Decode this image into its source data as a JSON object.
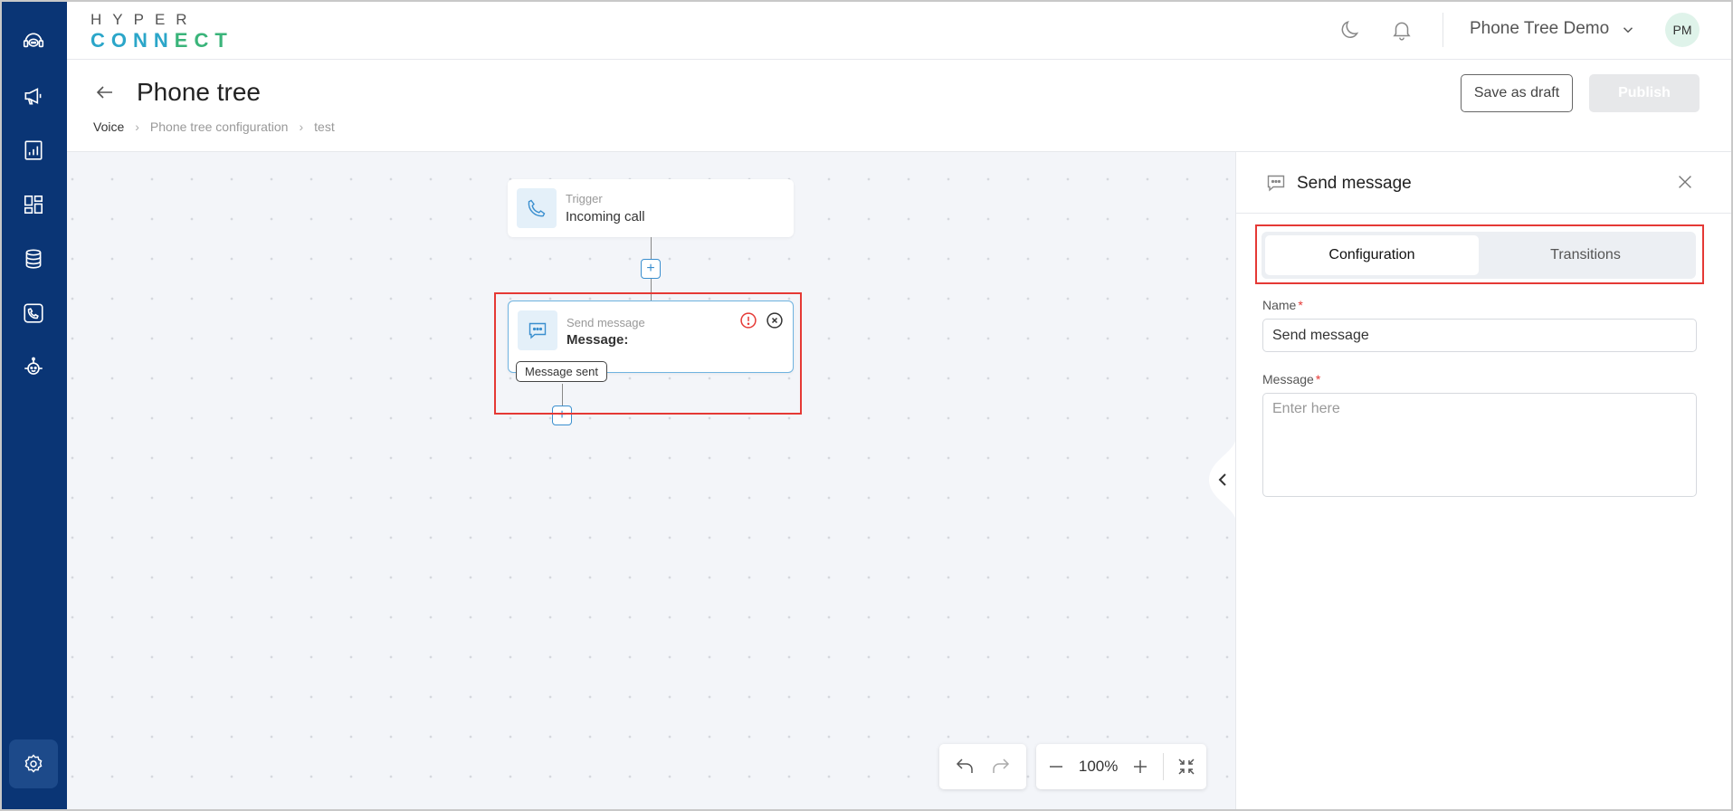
{
  "logo": {
    "top": "HYPER",
    "bottom_a": "CONN",
    "bottom_b": "ECT"
  },
  "header": {
    "org_name": "Phone Tree Demo",
    "avatar_initials": "PM"
  },
  "page": {
    "title": "Phone tree",
    "breadcrumb": [
      "Voice",
      "Phone tree configuration",
      "test"
    ],
    "save_draft_label": "Save as draft",
    "publish_label": "Publish"
  },
  "canvas": {
    "trigger_node": {
      "label": "Trigger",
      "value": "Incoming call"
    },
    "message_node": {
      "label": "Send message",
      "value": "Message:"
    },
    "transition_pill": "Message sent",
    "plus": "+",
    "zoom_level": "100%"
  },
  "panel": {
    "title": "Send message",
    "tabs": [
      {
        "label": "Configuration",
        "active": true
      },
      {
        "label": "Transitions",
        "active": false
      }
    ],
    "name_label": "Name",
    "name_value": "Send message",
    "message_label": "Message",
    "message_placeholder": "Enter here",
    "required_mark": "*"
  },
  "colors": {
    "sidebar": "#0a3575",
    "accent": "#3a8fcf",
    "highlight": "#e53935",
    "canvas_bg": "#f3f5f9"
  }
}
